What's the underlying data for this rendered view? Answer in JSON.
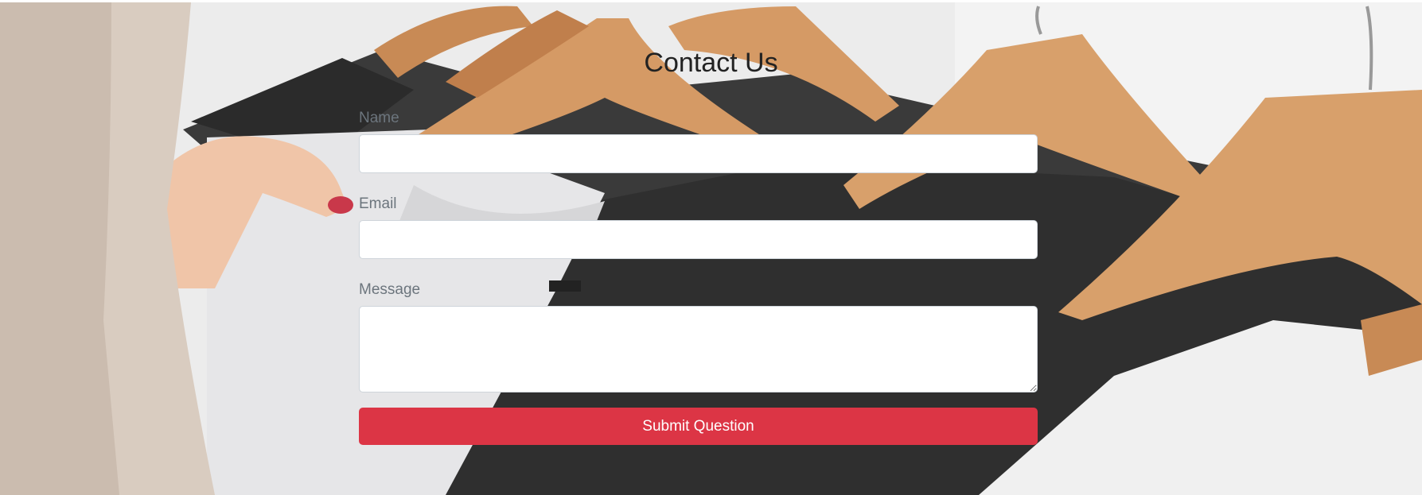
{
  "contact": {
    "title": "Contact Us",
    "name_label": "Name",
    "name_value": "",
    "email_label": "Email",
    "email_value": "",
    "message_label": "Message",
    "message_value": "",
    "submit_label": "Submit Question"
  },
  "colors": {
    "submit_bg": "#dc3545",
    "label": "#6c757d",
    "title": "#222222"
  }
}
